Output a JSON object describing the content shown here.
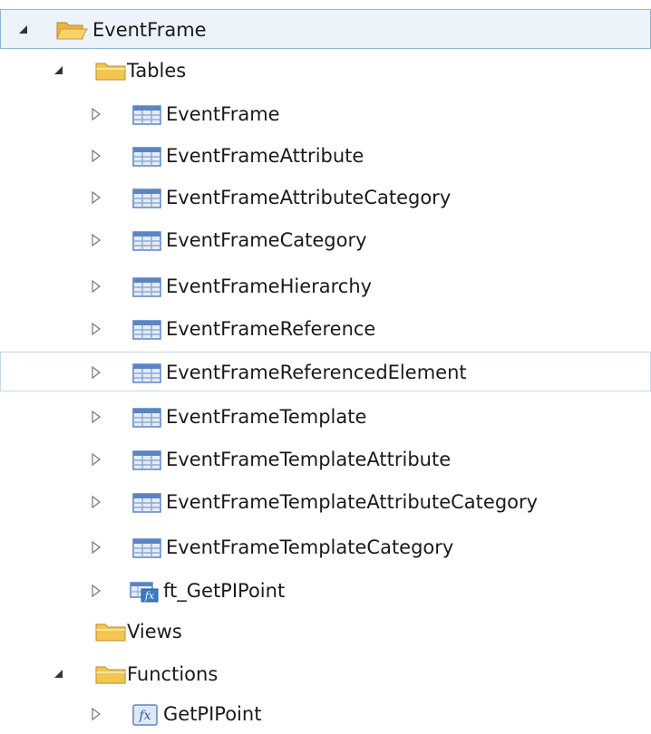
{
  "tree": {
    "root": {
      "label": "EventFrame",
      "expanded": true
    },
    "tables": {
      "label": "Tables",
      "expanded": true,
      "items": [
        {
          "label": "EventFrame",
          "type": "table"
        },
        {
          "label": "EventFrameAttribute",
          "type": "table"
        },
        {
          "label": "EventFrameAttributeCategory",
          "type": "table"
        },
        {
          "label": "EventFrameCategory",
          "type": "table"
        },
        {
          "label": "EventFrameHierarchy",
          "type": "table"
        },
        {
          "label": "EventFrameReference",
          "type": "table"
        },
        {
          "label": "EventFrameReferencedElement",
          "type": "table",
          "hovered": true
        },
        {
          "label": "EventFrameTemplate",
          "type": "table"
        },
        {
          "label": "EventFrameTemplateAttribute",
          "type": "table"
        },
        {
          "label": "EventFrameTemplateAttributeCategory",
          "type": "table"
        },
        {
          "label": "EventFrameTemplateCategory",
          "type": "table"
        },
        {
          "label": "ft_GetPIPoint",
          "type": "table-function"
        }
      ]
    },
    "views": {
      "label": "Views",
      "expanded": false
    },
    "functions": {
      "label": "Functions",
      "expanded": true,
      "items": [
        {
          "label": "GetPIPoint",
          "type": "function"
        }
      ]
    }
  },
  "colors": {
    "selection_bg": "#ecf3fb",
    "selection_border": "#8fb4d9",
    "hover_border": "#c3d7ec",
    "folder_yellow": "#f3c74f",
    "table_blue": "#5b84c4"
  }
}
